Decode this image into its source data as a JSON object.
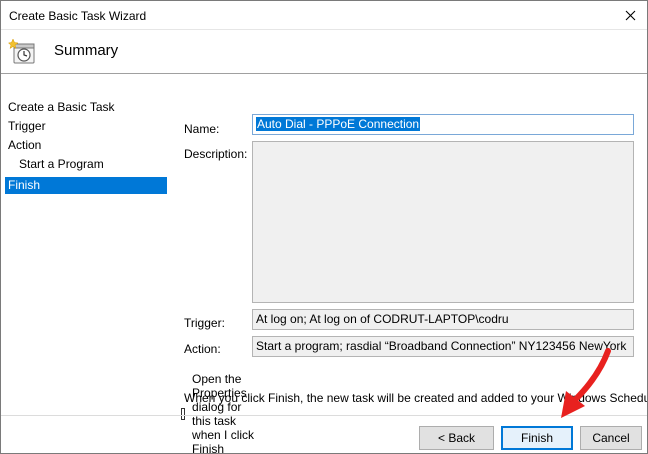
{
  "window": {
    "title": "Create Basic Task Wizard"
  },
  "header": {
    "title": "Summary",
    "icon": "task-scheduler-icon"
  },
  "sidebar": {
    "items": [
      {
        "label": "Create a Basic Task",
        "sub": false,
        "active": false
      },
      {
        "label": "Trigger",
        "sub": false,
        "active": false
      },
      {
        "label": "Action",
        "sub": false,
        "active": false
      },
      {
        "label": "Start a Program",
        "sub": true,
        "active": false
      },
      {
        "label": "Finish",
        "sub": false,
        "active": true
      }
    ]
  },
  "form": {
    "name_label": "Name:",
    "name_value": "Auto Dial - PPPoE Connection",
    "description_label": "Description:",
    "description_value": "",
    "trigger_label": "Trigger:",
    "trigger_value": "At log on; At log on of CODRUT-LAPTOP\\codru",
    "action_label": "Action:",
    "action_value": "Start a program; rasdial “Broadband Connection” NY123456 NewYork"
  },
  "checkbox": {
    "label": "Open the Properties dialog for this task when I click Finish",
    "checked": false
  },
  "info_text": "When you click Finish, the new task will be created and added to your Windows Schedule.",
  "buttons": {
    "back": "< Back",
    "finish": "Finish",
    "cancel": "Cancel"
  },
  "colors": {
    "accent": "#0078d7",
    "annotation_arrow": "#e8211f"
  }
}
